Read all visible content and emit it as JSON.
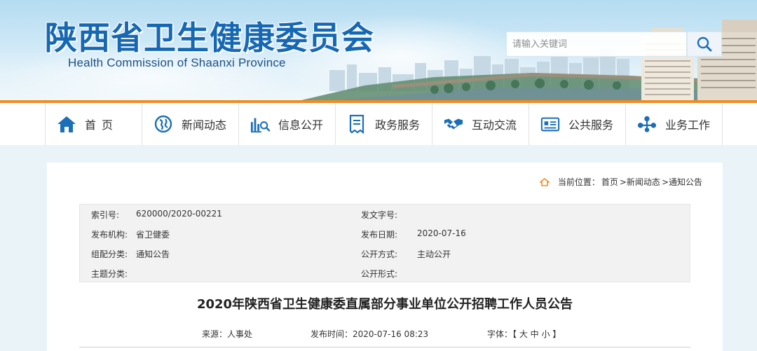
{
  "header": {
    "title_cn": "陕西省卫生健康委员会",
    "title_en": "Health Commission of Shaanxi Province",
    "search_placeholder": "请输入关键词"
  },
  "nav": {
    "accent_color": "#ef8d25",
    "items": [
      {
        "label": "首页",
        "icon": "home-icon"
      },
      {
        "label": "新闻动态",
        "icon": "globe-icon"
      },
      {
        "label": "信息公开",
        "icon": "chart-search-icon"
      },
      {
        "label": "政务服务",
        "icon": "document-icon"
      },
      {
        "label": "互动交流",
        "icon": "handshake-icon"
      },
      {
        "label": "公共服务",
        "icon": "card-icon"
      },
      {
        "label": "业务工作",
        "icon": "network-icon"
      }
    ]
  },
  "breadcrumb": {
    "prefix": "当前位置：",
    "items": [
      "首页",
      ">新闻动态",
      ">通知公告"
    ]
  },
  "info_table": {
    "rows": [
      {
        "k1": "索引号:",
        "v1": "620000/2020-00221",
        "k2": "发文字号:",
        "v2": ""
      },
      {
        "k1": "发布机构:",
        "v1": "省卫健委",
        "k2": "发布日期:",
        "v2": "2020-07-16"
      },
      {
        "k1": "组配分类:",
        "v1": "通知公告",
        "k2": "公开方式:",
        "v2": "主动公开"
      },
      {
        "k1": "主题分类:",
        "v1": "",
        "k2": "公开形式:",
        "v2": ""
      }
    ]
  },
  "article": {
    "title": "2020年陕西省卫生健康委直属部分事业单位公开招聘工作人员公告",
    "source": "来源：人事处",
    "publish_time": "发布时间：2020-07-16 08:23",
    "font_label": "字体：【 大 中 小 】"
  }
}
